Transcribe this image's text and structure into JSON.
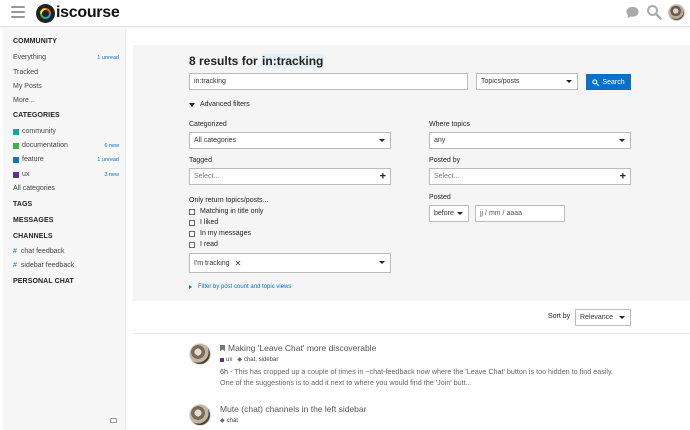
{
  "header": {
    "logo_text": "iscourse",
    "icons": [
      "hamburger-icon",
      "chat-icon",
      "search-icon",
      "avatar"
    ]
  },
  "sidebar": {
    "community_title": "COMMUNITY",
    "community_items": [
      {
        "label": "Everything",
        "badge": "1 unread"
      },
      {
        "label": "Tracked",
        "badge": ""
      },
      {
        "label": "My Posts",
        "badge": ""
      },
      {
        "label": "More...",
        "badge": ""
      }
    ],
    "categories_title": "CATEGORIES",
    "categories": [
      {
        "label": "community",
        "badge": "",
        "color": "#12a89d"
      },
      {
        "label": "documentation",
        "badge": "6 new",
        "color": "#3ab54a"
      },
      {
        "label": "feature",
        "badge": "1 unread",
        "color": "#0e76bd"
      },
      {
        "label": "ux",
        "badge": "3 new",
        "color": "#652d90"
      }
    ],
    "all_categories": "All categories",
    "tags_title": "TAGS",
    "messages_title": "MESSAGES",
    "channels_title": "CHANNELS",
    "channels": [
      {
        "label": "chat feedback"
      },
      {
        "label": "sidebar feedback"
      }
    ],
    "personal_chat_title": "PERSONAL CHAT"
  },
  "search": {
    "title_prefix": "8 results for",
    "title_query": "in:tracking",
    "query_value": "in:tracking",
    "type_select": "Topics/posts",
    "search_button": "Search",
    "advanced_label": "Advanced filters",
    "categorized_label": "Categorized",
    "categorized_value": "All categories",
    "where_topics_label": "Where topics",
    "where_topics_value": "any",
    "tagged_label": "Tagged",
    "tagged_placeholder": "Select...",
    "posted_by_label": "Posted by",
    "posted_by_placeholder": "Select...",
    "only_return_label": "Only return topics/posts...",
    "checkboxes": [
      "Matching in title only",
      "I liked",
      "In my messages",
      "I read"
    ],
    "tracking_chip": "I'm tracking",
    "posted_label": "Posted",
    "posted_when": "before",
    "date_placeholder": "jj / mm / aaaa",
    "filter_link": "Filter by post count and topic views",
    "sort_by_label": "Sort by",
    "sort_by_value": "Relevance"
  },
  "results": [
    {
      "title": "Making 'Leave Chat' more discoverable",
      "category": "ux",
      "tags": "chat, sidebar",
      "age": "6h",
      "blurb": "This has cropped up a couple of times in ~chat-feedback now where the 'Leave Chat' button is too hidden to find easily. One of the suggestions is to add it next to where you would find the 'Join' butt..."
    },
    {
      "title": "Mute (chat) channels in the left sidebar",
      "category": "",
      "tags": "chat",
      "age": "",
      "blurb": ""
    }
  ]
}
